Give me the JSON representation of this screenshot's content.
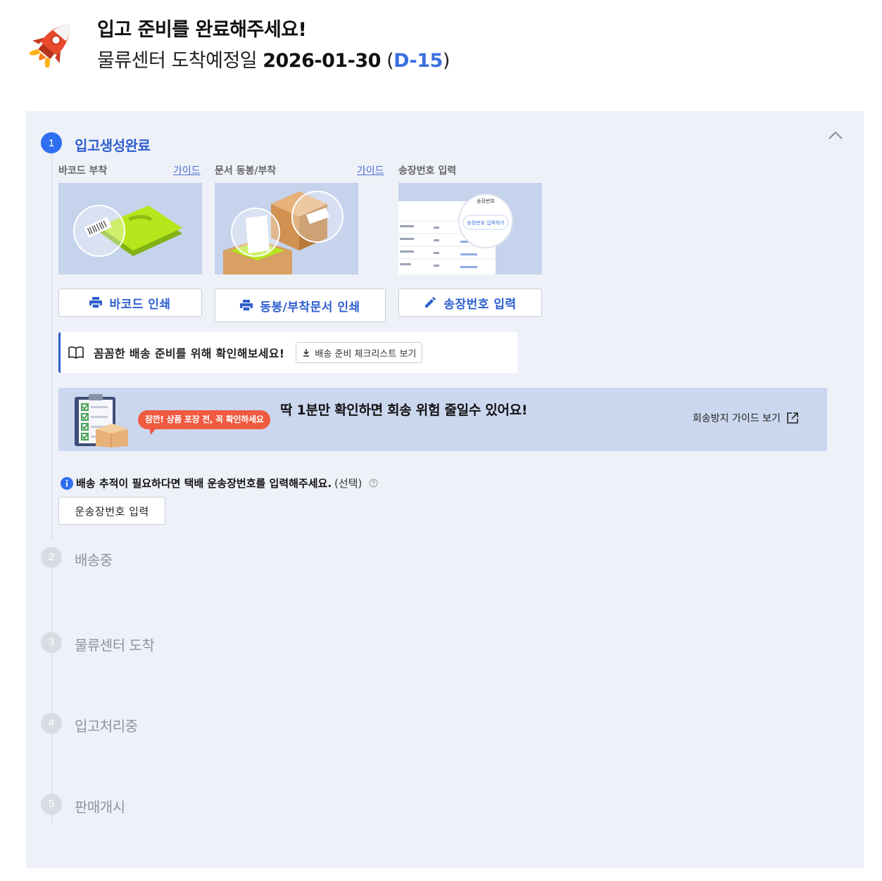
{
  "header": {
    "title": "입고 준비를 완료해주세요!",
    "subtitle_prefix": "물류센터 도착예정일",
    "arrival_date": "2026-01-30",
    "dday_open": "(",
    "dday": "D-15",
    "dday_close": ")"
  },
  "steps": [
    {
      "number": "1",
      "label": "입고생성완료",
      "status": "active"
    },
    {
      "number": "2",
      "label": "배송중",
      "status": "inactive"
    },
    {
      "number": "3",
      "label": "물류센터 도착",
      "status": "inactive"
    },
    {
      "number": "4",
      "label": "입고처리중",
      "status": "inactive"
    },
    {
      "number": "5",
      "label": "판매개시",
      "status": "inactive"
    }
  ],
  "cards": {
    "barcode": {
      "title": "바코드 부착",
      "guide": "가이드",
      "button": "바코드 인쇄"
    },
    "document": {
      "title": "문서 동봉/부착",
      "guide": "가이드",
      "button": "동봉/부착문서 인쇄"
    },
    "invoice": {
      "title": "송장번호 입력",
      "button": "송장번호 입력",
      "popup_title": "송장번호",
      "popup_action": "송장번호 입력하기"
    }
  },
  "notice": {
    "text": "꼼꼼한 배송 준비를 위해 확인해보세요!",
    "checklist_button": "배송 준비 체크리스트 보기"
  },
  "banner": {
    "bubble": "잠깐! 상품 포장 전, 꼭 확인하세요",
    "message": "딱 1분만 확인하면 회송 위험 줄일수 있어요!",
    "link": "회송방지 가이드 보기"
  },
  "tracking": {
    "text": "배송 추적이 필요하다면 택배 운송장번호를 입력해주세요.",
    "optional": "(선택)",
    "button": "운송장번호 입력"
  },
  "colors": {
    "accent": "#2f6ef0",
    "panel_bg": "#eef1f8",
    "banner_bg": "#cbd7ee",
    "bubble": "#f05a40"
  }
}
